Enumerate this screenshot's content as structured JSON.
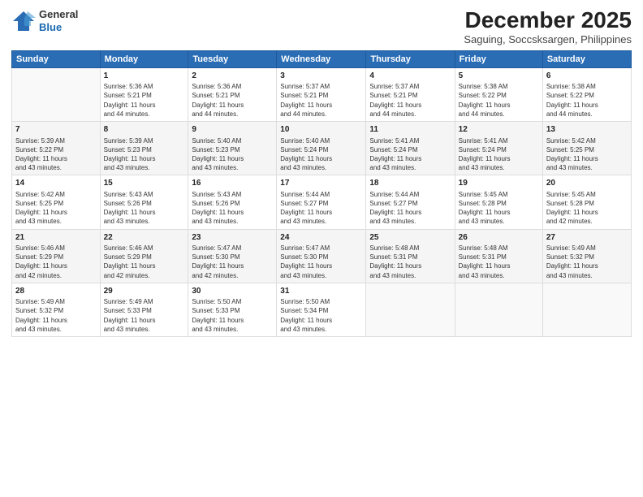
{
  "header": {
    "logo_line1": "General",
    "logo_line2": "Blue",
    "month": "December 2025",
    "location": "Saguing, Soccsksargen, Philippines"
  },
  "weekdays": [
    "Sunday",
    "Monday",
    "Tuesday",
    "Wednesday",
    "Thursday",
    "Friday",
    "Saturday"
  ],
  "weeks": [
    [
      {
        "day": "",
        "info": ""
      },
      {
        "day": "1",
        "info": "Sunrise: 5:36 AM\nSunset: 5:21 PM\nDaylight: 11 hours\nand 44 minutes."
      },
      {
        "day": "2",
        "info": "Sunrise: 5:36 AM\nSunset: 5:21 PM\nDaylight: 11 hours\nand 44 minutes."
      },
      {
        "day": "3",
        "info": "Sunrise: 5:37 AM\nSunset: 5:21 PM\nDaylight: 11 hours\nand 44 minutes."
      },
      {
        "day": "4",
        "info": "Sunrise: 5:37 AM\nSunset: 5:21 PM\nDaylight: 11 hours\nand 44 minutes."
      },
      {
        "day": "5",
        "info": "Sunrise: 5:38 AM\nSunset: 5:22 PM\nDaylight: 11 hours\nand 44 minutes."
      },
      {
        "day": "6",
        "info": "Sunrise: 5:38 AM\nSunset: 5:22 PM\nDaylight: 11 hours\nand 44 minutes."
      }
    ],
    [
      {
        "day": "7",
        "info": "Sunrise: 5:39 AM\nSunset: 5:22 PM\nDaylight: 11 hours\nand 43 minutes."
      },
      {
        "day": "8",
        "info": "Sunrise: 5:39 AM\nSunset: 5:23 PM\nDaylight: 11 hours\nand 43 minutes."
      },
      {
        "day": "9",
        "info": "Sunrise: 5:40 AM\nSunset: 5:23 PM\nDaylight: 11 hours\nand 43 minutes."
      },
      {
        "day": "10",
        "info": "Sunrise: 5:40 AM\nSunset: 5:24 PM\nDaylight: 11 hours\nand 43 minutes."
      },
      {
        "day": "11",
        "info": "Sunrise: 5:41 AM\nSunset: 5:24 PM\nDaylight: 11 hours\nand 43 minutes."
      },
      {
        "day": "12",
        "info": "Sunrise: 5:41 AM\nSunset: 5:24 PM\nDaylight: 11 hours\nand 43 minutes."
      },
      {
        "day": "13",
        "info": "Sunrise: 5:42 AM\nSunset: 5:25 PM\nDaylight: 11 hours\nand 43 minutes."
      }
    ],
    [
      {
        "day": "14",
        "info": "Sunrise: 5:42 AM\nSunset: 5:25 PM\nDaylight: 11 hours\nand 43 minutes."
      },
      {
        "day": "15",
        "info": "Sunrise: 5:43 AM\nSunset: 5:26 PM\nDaylight: 11 hours\nand 43 minutes."
      },
      {
        "day": "16",
        "info": "Sunrise: 5:43 AM\nSunset: 5:26 PM\nDaylight: 11 hours\nand 43 minutes."
      },
      {
        "day": "17",
        "info": "Sunrise: 5:44 AM\nSunset: 5:27 PM\nDaylight: 11 hours\nand 43 minutes."
      },
      {
        "day": "18",
        "info": "Sunrise: 5:44 AM\nSunset: 5:27 PM\nDaylight: 11 hours\nand 43 minutes."
      },
      {
        "day": "19",
        "info": "Sunrise: 5:45 AM\nSunset: 5:28 PM\nDaylight: 11 hours\nand 43 minutes."
      },
      {
        "day": "20",
        "info": "Sunrise: 5:45 AM\nSunset: 5:28 PM\nDaylight: 11 hours\nand 42 minutes."
      }
    ],
    [
      {
        "day": "21",
        "info": "Sunrise: 5:46 AM\nSunset: 5:29 PM\nDaylight: 11 hours\nand 42 minutes."
      },
      {
        "day": "22",
        "info": "Sunrise: 5:46 AM\nSunset: 5:29 PM\nDaylight: 11 hours\nand 42 minutes."
      },
      {
        "day": "23",
        "info": "Sunrise: 5:47 AM\nSunset: 5:30 PM\nDaylight: 11 hours\nand 42 minutes."
      },
      {
        "day": "24",
        "info": "Sunrise: 5:47 AM\nSunset: 5:30 PM\nDaylight: 11 hours\nand 43 minutes."
      },
      {
        "day": "25",
        "info": "Sunrise: 5:48 AM\nSunset: 5:31 PM\nDaylight: 11 hours\nand 43 minutes."
      },
      {
        "day": "26",
        "info": "Sunrise: 5:48 AM\nSunset: 5:31 PM\nDaylight: 11 hours\nand 43 minutes."
      },
      {
        "day": "27",
        "info": "Sunrise: 5:49 AM\nSunset: 5:32 PM\nDaylight: 11 hours\nand 43 minutes."
      }
    ],
    [
      {
        "day": "28",
        "info": "Sunrise: 5:49 AM\nSunset: 5:32 PM\nDaylight: 11 hours\nand 43 minutes."
      },
      {
        "day": "29",
        "info": "Sunrise: 5:49 AM\nSunset: 5:33 PM\nDaylight: 11 hours\nand 43 minutes."
      },
      {
        "day": "30",
        "info": "Sunrise: 5:50 AM\nSunset: 5:33 PM\nDaylight: 11 hours\nand 43 minutes."
      },
      {
        "day": "31",
        "info": "Sunrise: 5:50 AM\nSunset: 5:34 PM\nDaylight: 11 hours\nand 43 minutes."
      },
      {
        "day": "",
        "info": ""
      },
      {
        "day": "",
        "info": ""
      },
      {
        "day": "",
        "info": ""
      }
    ]
  ]
}
